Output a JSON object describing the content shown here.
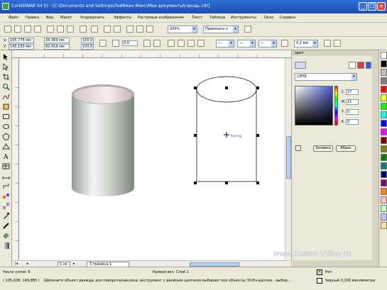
{
  "window": {
    "title": "CorelDRAW X4 (I) - [C:\\Documents and Settings\\Лейбман Макс\\Мои документы\\гвоздь.cdr]",
    "minimize": "_",
    "restore": "❐",
    "close": "×"
  },
  "menu": [
    "Файл",
    "Правка",
    "Вид",
    "Макет",
    "Упорядочить",
    "Эффекты",
    "Растровые изображения",
    "Текст",
    "Таблица",
    "Инструменты",
    "Окно",
    "Справка"
  ],
  "toolbar": {
    "zoom": "200%",
    "snap": "Привязать к"
  },
  "propbar": {
    "x": "165,776 мм",
    "y": "145,193 мм",
    "w": "34,369 мм",
    "h": "82,419 мм",
    "sx": "100,0",
    "sy": "100,0",
    "angle": "0,0",
    "outline": "0,2 мм"
  },
  "canvas": {
    "center_label": "Контур"
  },
  "docker": {
    "title": "Цвет",
    "model": "CMYK",
    "c_label": "C",
    "c_value": "17",
    "m_label": "M",
    "m_value": "11",
    "y_label": "Y",
    "y_value": "0",
    "k_label": "K",
    "k_value": "0",
    "fill_button": "Заливка",
    "outline_button": "Абрис"
  },
  "palette_colors": [
    "#ffffff",
    "#000000",
    "#c0c0c0",
    "#808080",
    "#ff0000",
    "#ffff00",
    "#00ff00",
    "#00ffff",
    "#0000ff",
    "#ff00ff",
    "#800000",
    "#808000",
    "#008000",
    "#008080",
    "#000080",
    "#800080",
    "#ff8000",
    "#ffc0c0",
    "#c0ffc0",
    "#c0c0ff",
    "#ffe0a0"
  ],
  "pages": {
    "counter": "1 из 1",
    "tab": "Страница 1"
  },
  "status": {
    "left": "Число узлов: 8",
    "layer": "Кривая вкл. Слой 1",
    "coords": "( 105,206; 149,885 )",
    "hint": "Щёлкните объект дважды для поворота/наклона; инструмент с двойным щелчком выбирает все объекты; Shift+щелчок - выбор...",
    "fill": "Нет",
    "outline": "Черный  0,200 миллиметра"
  },
  "watermark": "www.Status-Video.ru"
}
